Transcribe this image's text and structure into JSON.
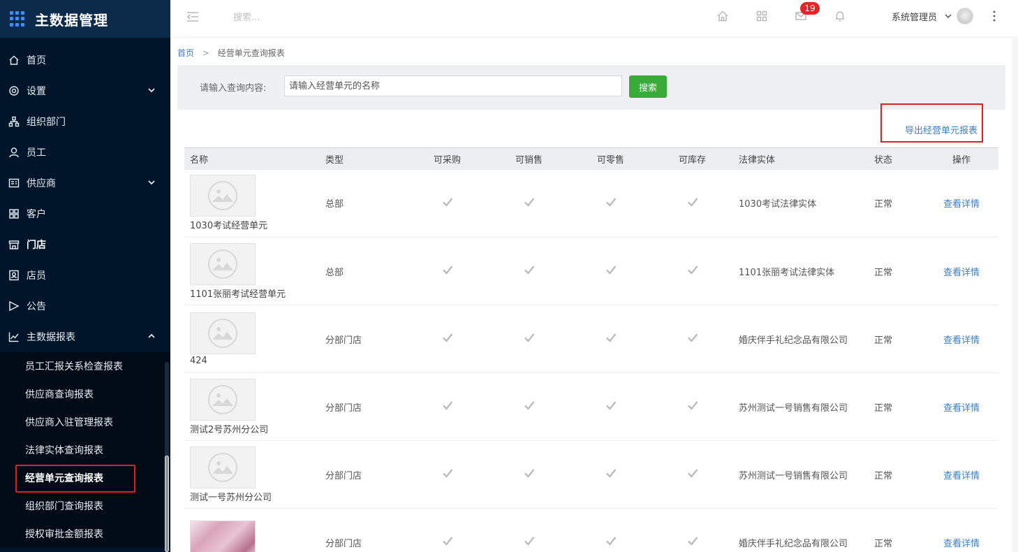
{
  "brand": {
    "title": "主数据管理"
  },
  "sidebar": {
    "items": [
      {
        "label": "首页",
        "icon": "home-icon",
        "expandable": false
      },
      {
        "label": "设置",
        "icon": "gear-icon",
        "expandable": true
      },
      {
        "label": "组织部门",
        "icon": "org-icon",
        "expandable": false
      },
      {
        "label": "员工",
        "icon": "user-icon",
        "expandable": false
      },
      {
        "label": "供应商",
        "icon": "supplier-icon",
        "expandable": true
      },
      {
        "label": "客户",
        "icon": "customer-icon",
        "expandable": false
      },
      {
        "label": "门店",
        "icon": "store-icon",
        "expandable": false
      },
      {
        "label": "店员",
        "icon": "clerk-icon",
        "expandable": false
      },
      {
        "label": "公告",
        "icon": "announcement-icon",
        "expandable": false
      },
      {
        "label": "主数据报表",
        "icon": "chart-icon",
        "expandable": true,
        "expanded": true
      }
    ],
    "report_submenu": [
      "员工汇报关系检查报表",
      "供应商查询报表",
      "供应商入驻管理报表",
      "法律实体查询报表",
      "经营单元查询报表",
      "组织部门查询报表",
      "授权审批金额报表"
    ],
    "active_submenu": "经营单元查询报表"
  },
  "header": {
    "search_placeholder": "搜索...",
    "message_badge": "19",
    "user_name": "系统管理员"
  },
  "breadcrumb": {
    "home": "首页",
    "separator": ">",
    "current": "经营单元查询报表"
  },
  "search_panel": {
    "label": "请输入查询内容:",
    "placeholder": "请输入经营单元的名称",
    "button": "搜索"
  },
  "export_link": "导出经营单元报表",
  "table": {
    "headers": [
      "名称",
      "类型",
      "可采购",
      "可销售",
      "可零售",
      "可库存",
      "法律实体",
      "状态",
      "操作"
    ],
    "rows": [
      {
        "name": "1030考试经营单元",
        "type": "总部",
        "legal": "1030考试法律实体",
        "status": "正常",
        "action": "查看详情",
        "thumb": "placeholder"
      },
      {
        "name": "1101张丽考试经营单元",
        "type": "总部",
        "legal": "1101张丽考试法律实体",
        "status": "正常",
        "action": "查看详情",
        "thumb": "placeholder"
      },
      {
        "name": "424",
        "type": "分部门店",
        "legal": "婚庆伴手礼纪念品有限公司",
        "status": "正常",
        "action": "查看详情",
        "thumb": "placeholder"
      },
      {
        "name": "测试2号苏州分公司",
        "type": "分部门店",
        "legal": "苏州测试一号销售有限公司",
        "status": "正常",
        "action": "查看详情",
        "thumb": "placeholder"
      },
      {
        "name": "测试一号苏州分公司",
        "type": "分部门店",
        "legal": "苏州测试一号销售有限公司",
        "status": "正常",
        "action": "查看详情",
        "thumb": "placeholder"
      },
      {
        "name": "",
        "type": "分部门店",
        "legal": "婚庆伴手礼纪念品有限公司",
        "status": "正常",
        "action": "查看详情",
        "thumb": "photo"
      }
    ]
  }
}
